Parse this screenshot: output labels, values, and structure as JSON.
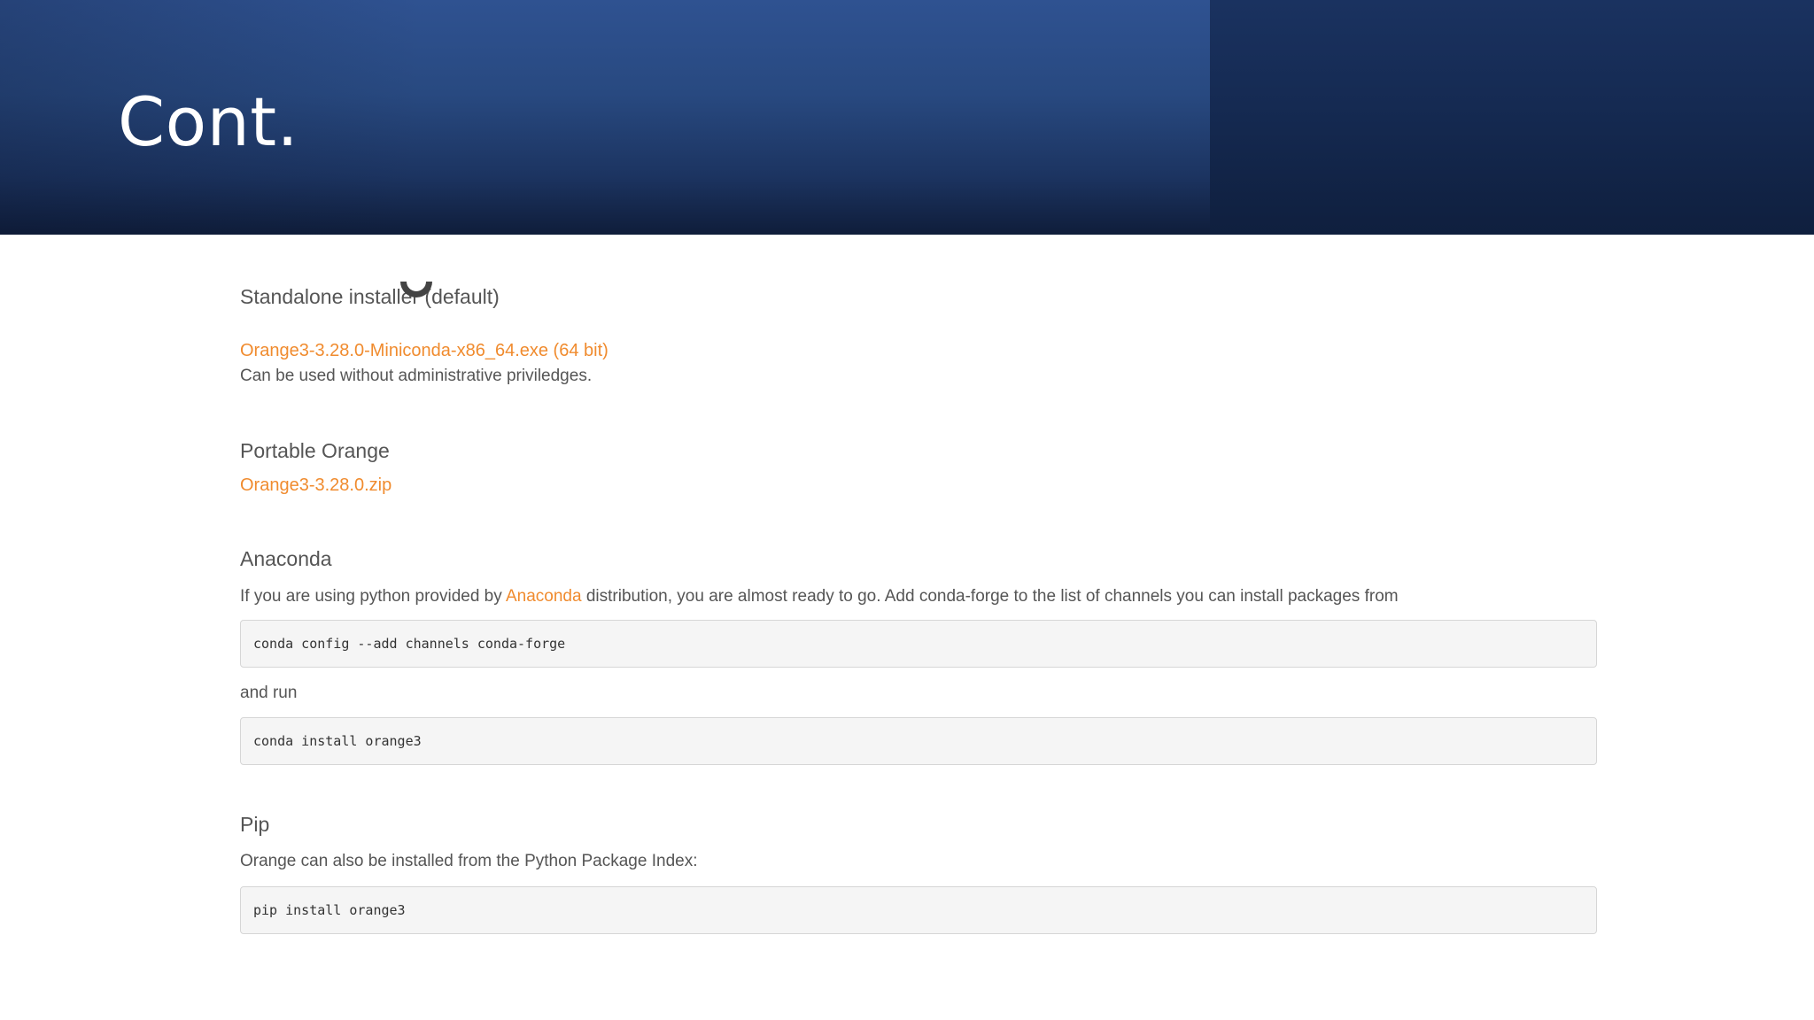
{
  "slide": {
    "title": "Cont."
  },
  "standalone": {
    "heading": "Standalone installer (default)",
    "link": "Orange3-3.28.0-Miniconda-x86_64.exe (64 bit)",
    "note": "Can be used without administrative priviledges."
  },
  "portable": {
    "heading": "Portable Orange",
    "link": "Orange3-3.28.0.zip"
  },
  "anaconda": {
    "heading": "Anaconda",
    "text_before": "If you are using python provided by ",
    "link": "Anaconda",
    "text_after": " distribution, you are almost ready to go. Add conda-forge to the list of channels you can install packages from",
    "code1": "conda config --add channels conda-forge",
    "and_run": "and run",
    "code2": "conda install orange3"
  },
  "pip": {
    "heading": "Pip",
    "text": "Orange can also be installed from the Python Package Index:",
    "code": "pip install orange3"
  },
  "colors": {
    "header_blue": "#2f5291",
    "header_dark": "#152a52",
    "link_orange": "#f08b2e",
    "text_gray": "#555555",
    "code_bg": "#f5f5f5"
  },
  "icons": {
    "loading": "loading-spinner-icon"
  }
}
